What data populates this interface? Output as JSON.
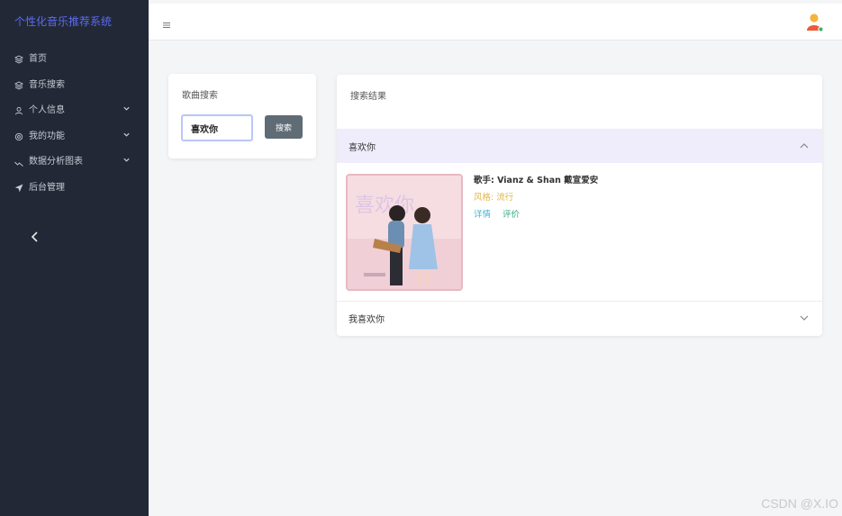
{
  "app": {
    "title": "个性化音乐推荐系统"
  },
  "sidebar": {
    "items": [
      {
        "label": "首页",
        "icon": "layers-icon",
        "expandable": false
      },
      {
        "label": "音乐搜索",
        "icon": "layers-icon",
        "expandable": false
      },
      {
        "label": "个人信息",
        "icon": "user-icon",
        "expandable": true
      },
      {
        "label": "我的功能",
        "icon": "gear-icon",
        "expandable": true
      },
      {
        "label": "数据分析图表",
        "icon": "trend-icon",
        "expandable": true
      },
      {
        "label": "后台管理",
        "icon": "send-icon",
        "expandable": false
      }
    ]
  },
  "search": {
    "title": "歌曲搜索",
    "value": "喜欢你",
    "button_label": "搜索"
  },
  "results": {
    "title": "搜索结果",
    "items": [
      {
        "name": "喜欢你",
        "expanded": true,
        "singer_label": "歌手: ",
        "singer": "Vianz & Shan 戴宣爱安",
        "style_label": "风格: ",
        "style": "流行",
        "detail_link": "详情",
        "rate_link": "评价"
      },
      {
        "name": "我喜欢你",
        "expanded": false
      }
    ]
  },
  "watermark": "CSDN @X.IO",
  "colors": {
    "sidebar_bg": "#222836",
    "brand": "#5b6bf0",
    "accent_active_row": "#efedfb",
    "search_button": "#5f6b75",
    "style_text": "#e0b848",
    "link_detail": "#3db5d6",
    "link_rate": "#3aab8a"
  }
}
